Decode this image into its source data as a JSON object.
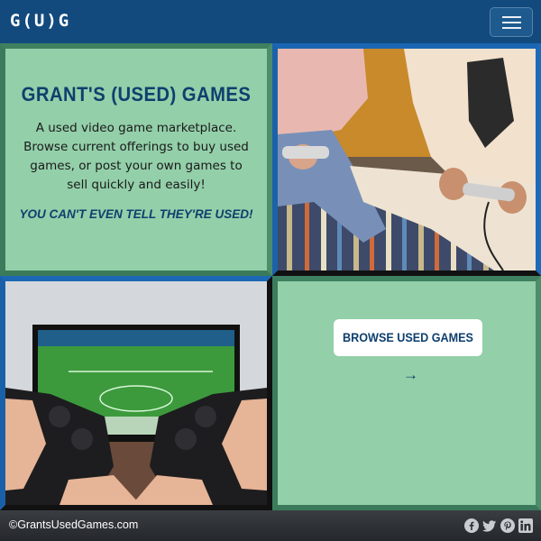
{
  "navbar": {
    "brand": "G(U)G",
    "menu_toggle": "menu-icon"
  },
  "hero": {
    "title": "GRANT'S (USED) GAMES",
    "description": "A used video game marketplace. Browse current offerings to buy used games, or post your own games to sell quickly and easily!",
    "tagline": "YOU CAN'T EVEN TELL THEY'RE USED!"
  },
  "images": {
    "top_right": "people-playing-retro-console-photo",
    "bottom_left": "hands-holding-gamepads-soccer-tv-photo"
  },
  "cta": {
    "label": "BROWSE USED GAMES",
    "arrow": "→"
  },
  "footer": {
    "copyright": "©GrantsUsedGames.com",
    "social": [
      "facebook-icon",
      "twitter-icon",
      "pinterest-icon",
      "linkedin-icon"
    ]
  },
  "colors": {
    "navbar": "#124a7e",
    "mint": "#93cfa9",
    "navy": "#0f3f6e",
    "footer": "#2f3236"
  }
}
